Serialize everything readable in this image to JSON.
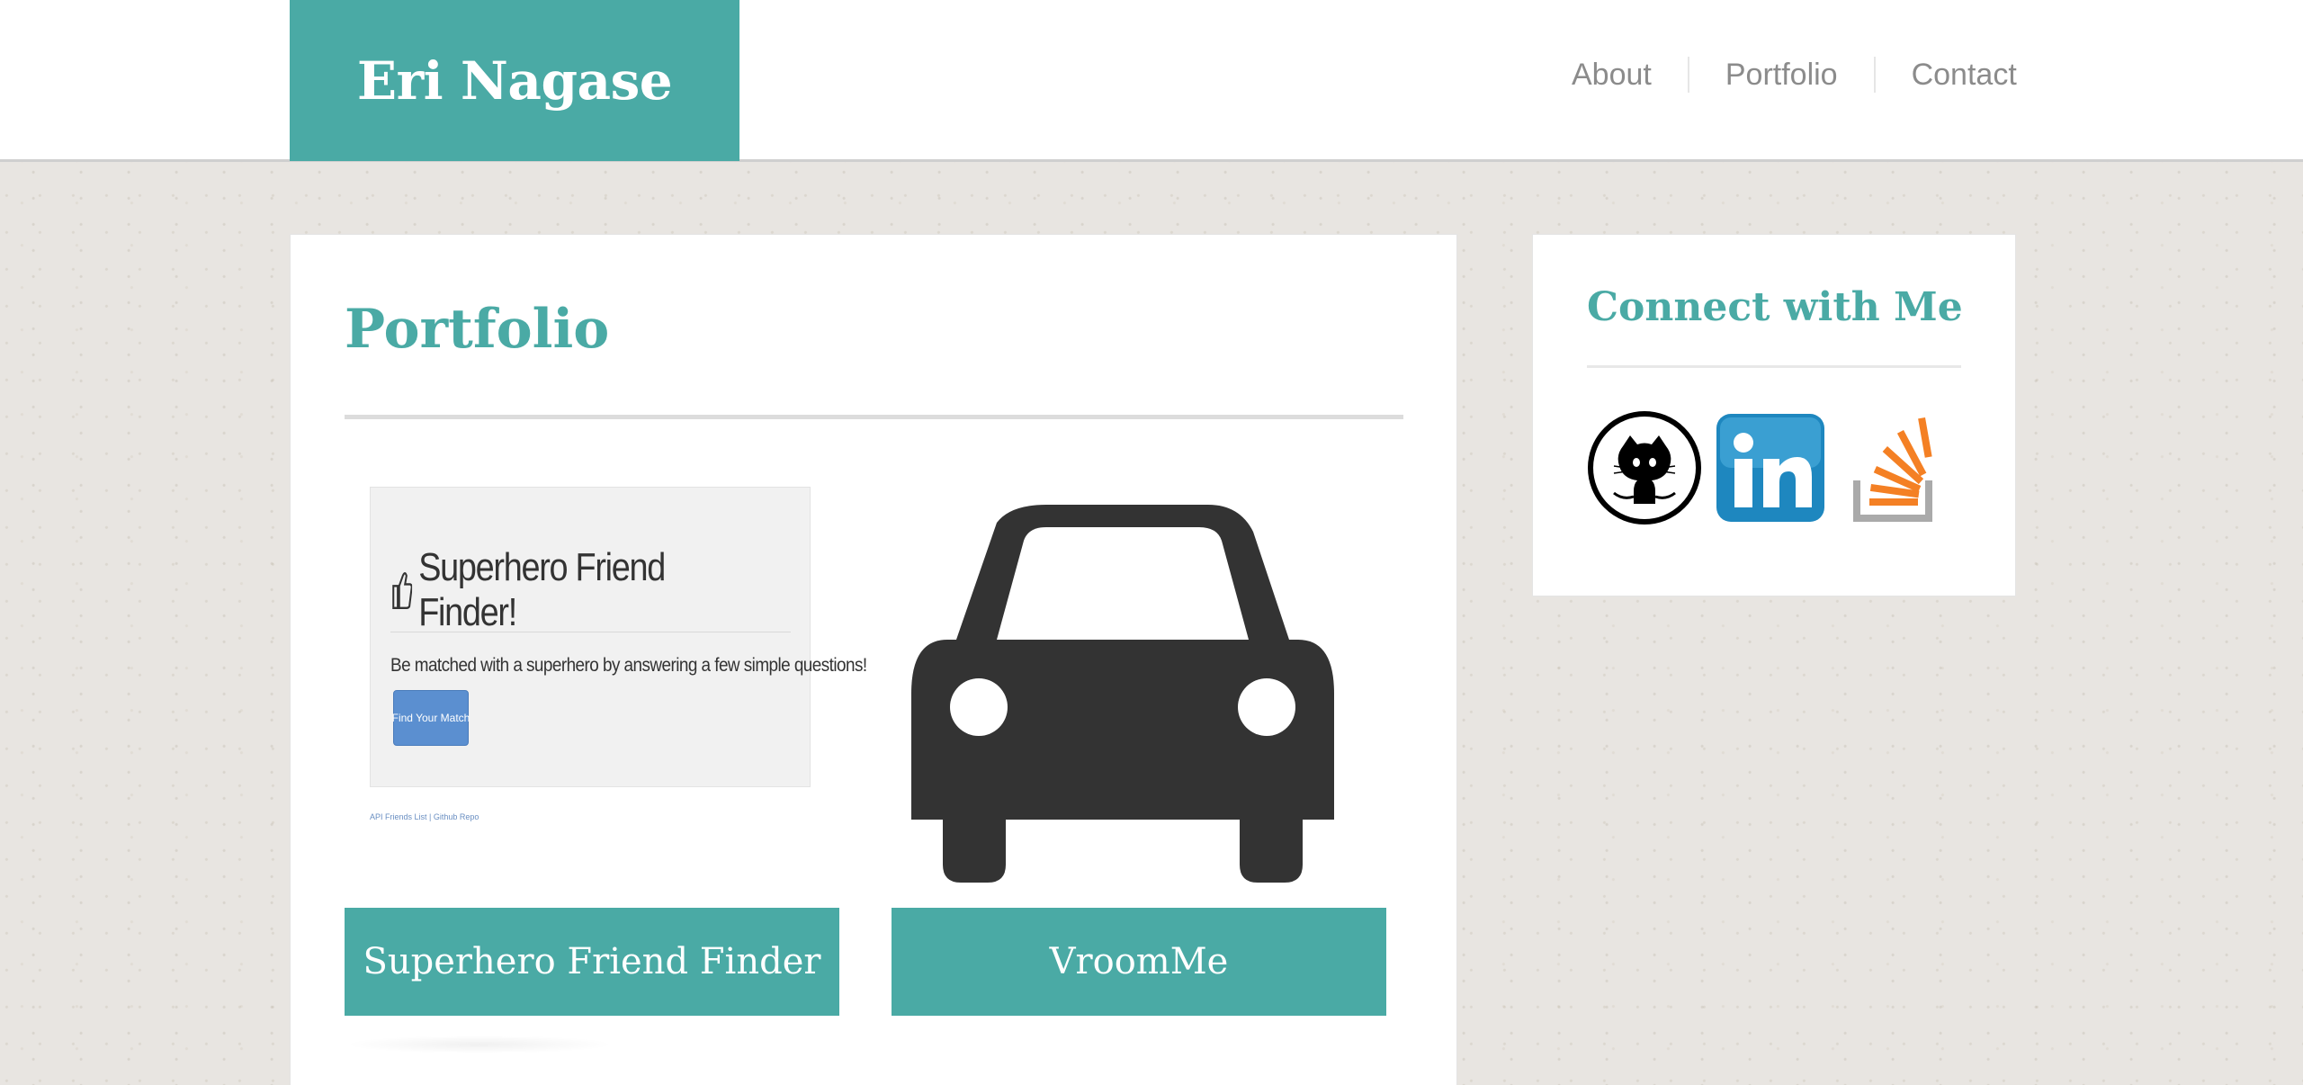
{
  "header": {
    "brand": "Eri Nagase",
    "nav": [
      {
        "label": "About"
      },
      {
        "label": "Portfolio"
      },
      {
        "label": "Contact"
      }
    ]
  },
  "main": {
    "title": "Portfolio",
    "projects": [
      {
        "label": "Superhero Friend Finder",
        "preview": {
          "heading": "Superhero Friend Finder!",
          "text": "Be matched with a superhero by answering a few simple questions!",
          "button": "Find Your Match",
          "links": "API Friends List | Github Repo"
        }
      },
      {
        "label": "VroomMe",
        "icon": "car-icon"
      }
    ]
  },
  "sidebar": {
    "title": "Connect with Me",
    "links": [
      {
        "icon": "github-icon"
      },
      {
        "icon": "linkedin-icon"
      },
      {
        "icon": "stackoverflow-icon"
      }
    ]
  },
  "colors": {
    "accent": "#4aaaa5",
    "nav_text": "#8b8b8b",
    "background": "#e8e5e1"
  }
}
